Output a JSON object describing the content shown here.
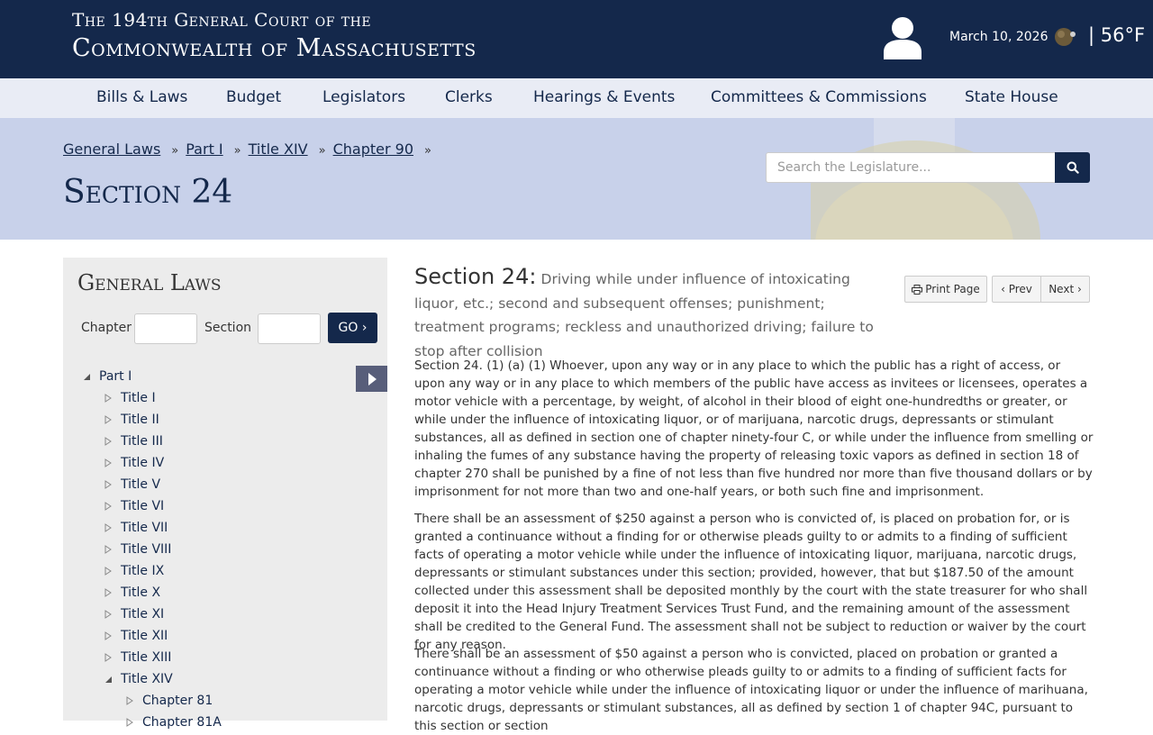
{
  "header": {
    "line1": "The 194th General Court of the",
    "line2": "Commonwealth of Massachusetts",
    "date": "March 10, 2026",
    "temperature": "| 56°F"
  },
  "nav": [
    "Bills & Laws",
    "Budget",
    "Legislators",
    "Clerks",
    "Hearings & Events",
    "Committees & Commissions",
    "State House"
  ],
  "breadcrumb": [
    "General Laws",
    "Part I",
    "Title XIV",
    "Chapter 90"
  ],
  "breadcrumb_sep": "»",
  "page_title": "Section 24",
  "search": {
    "placeholder": "Search the Legislature..."
  },
  "sidebar": {
    "title": "General Laws",
    "chapter_label": "Chapter",
    "section_label": "Section",
    "go_label": "GO ›",
    "tree": {
      "part": "Part I",
      "titles": [
        "Title I",
        "Title II",
        "Title III",
        "Title IV",
        "Title V",
        "Title VI",
        "Title VII",
        "Title VIII",
        "Title IX",
        "Title X",
        "Title XI",
        "Title XII",
        "Title XIII",
        "Title XIV"
      ],
      "chapters": [
        "Chapter 81",
        "Chapter 81A"
      ]
    }
  },
  "content": {
    "section_label": "Section 24:",
    "section_desc": "Driving while under influence of intoxicating liquor, etc.; second and subsequent offenses; punishment; treatment programs; reckless and unauthorized driving; failure to stop after collision",
    "print_label": "Print Page",
    "prev_label": "‹ Prev",
    "next_label": "Next ›",
    "paragraphs": [
      "Section 24. (1) (a) (1) Whoever, upon any way or in any place to which the public has a right of access, or upon any way or in any place to which members of the public have access as invitees or licensees, operates a motor vehicle with a percentage, by weight, of alcohol in their blood of eight one-hundredths or greater, or while under the influence of intoxicating liquor, or of marijuana, narcotic drugs, depressants or stimulant substances, all as defined in section one of chapter ninety-four C, or while under the influence from smelling or inhaling the fumes of any substance having the property of releasing toxic vapors as defined in section 18 of chapter 270 shall be punished by a fine of not less than five hundred nor more than five thousand dollars or by imprisonment for not more than two and one-half years, or both such fine and imprisonment.",
      "There shall be an assessment of $250 against a person who is convicted of, is placed on probation for, or is granted a continuance without a finding for or otherwise pleads guilty to or admits to a finding of sufficient facts of operating a motor vehicle while under the influence of intoxicating liquor, marijuana, narcotic drugs, depressants or stimulant substances under this section; provided, however, that but $187.50 of the amount collected under this assessment shall be deposited monthly by the court with the state treasurer for who shall deposit it into the Head Injury Treatment Services Trust Fund, and the remaining amount of the assessment shall be credited to the General Fund. The assessment shall not be subject to reduction or waiver by the court for any reason.",
      "There shall be an assessment of $50 against a person who is convicted, placed on probation or granted a continuance without a finding or who otherwise pleads guilty to or admits to a finding of sufficient facts for operating a motor vehicle while under the influence of intoxicating liquor or under the influence of marihuana, narcotic drugs, depressants or stimulant substances, all as defined by section 1 of chapter 94C, pursuant to this section or section"
    ]
  },
  "colors": {
    "navy": "#14284b",
    "banner": "#c8d1ea",
    "nav_bg": "#e9ecf5",
    "sidebar_bg": "#ececec"
  }
}
